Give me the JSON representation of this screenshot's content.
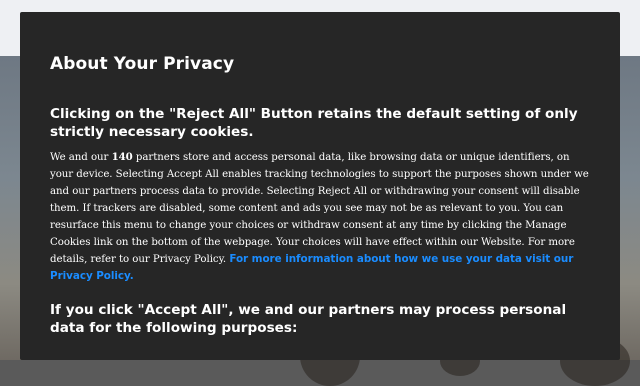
{
  "dialog": {
    "title": "About Your Privacy",
    "reject_heading": "Clicking on the \"Reject All\" Button retains the default setting of only strictly necessary cookies.",
    "body_prefix": "We and our",
    "partner_count": "140",
    "body_text": "partners store and access personal data, like browsing data or unique identifiers, on your device. Selecting Accept All enables tracking technologies to support the purposes shown under we and our partners process data to provide. Selecting Reject All or withdrawing your consent will disable them. If trackers are disabled, some content and ads you see may not be as relevant to you. You can resurface this menu to change your choices or withdraw consent at any time by clicking the Manage Cookies link on the bottom of the webpage. Your choices will have effect within our Website. For more details, refer to our Privacy Policy.",
    "more_info_link": "For more information about how we use your data visit our Privacy Policy.",
    "accept_heading": "If you click \"Accept All\", we and our partners may process personal data for the following purposes:"
  },
  "colors": {
    "dialog_bg": "#262626",
    "text": "#ffffff",
    "link": "#1a8cff"
  }
}
